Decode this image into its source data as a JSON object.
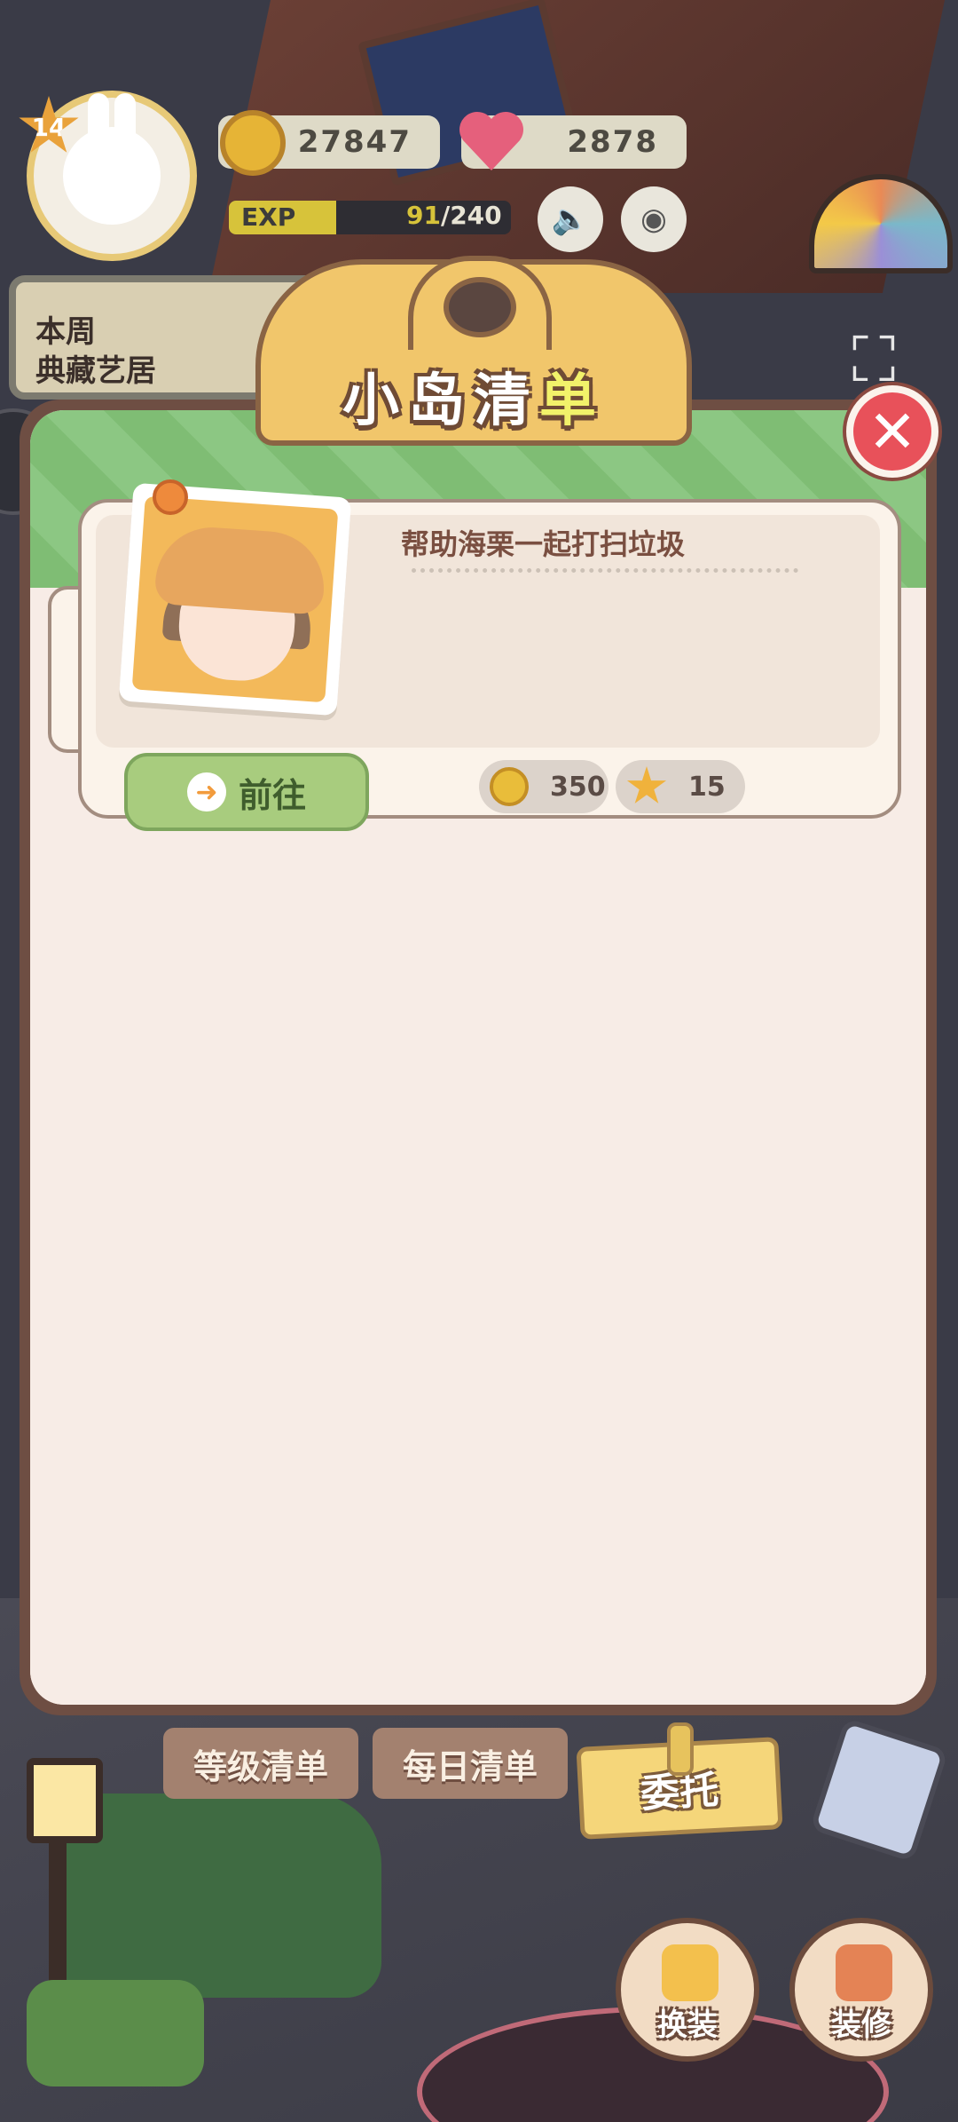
{
  "hud": {
    "level": "14",
    "coins": "27847",
    "hearts": "2878",
    "exp_label": "EXP",
    "exp_current": "91",
    "exp_total": "/240",
    "exp_progress": 0.38,
    "weekly_banner": "本周\n典藏艺居"
  },
  "panel": {
    "title_part1": "小岛清",
    "title_part2": "单",
    "close_label": "✕"
  },
  "task": {
    "title": "帮助海栗一起打扫垃圾",
    "go_label": "前往",
    "go_arrow": "➜",
    "reward_coins": "350",
    "reward_stars": "15"
  },
  "tabs": {
    "level_list": "等级清单",
    "daily_list": "每日清单",
    "commission": "委托"
  },
  "actions": {
    "dress_up": "换装",
    "decorate": "装修"
  },
  "icons": {
    "side_arrow": "›",
    "speaker": "🔈",
    "camera": "◉",
    "fullscreen": "⛶"
  },
  "colors": {
    "accent_green": "#a8cc7e",
    "close_red": "#e8515a",
    "panel_brown": "#6e4e43",
    "title_gold": "#f1c66b"
  }
}
